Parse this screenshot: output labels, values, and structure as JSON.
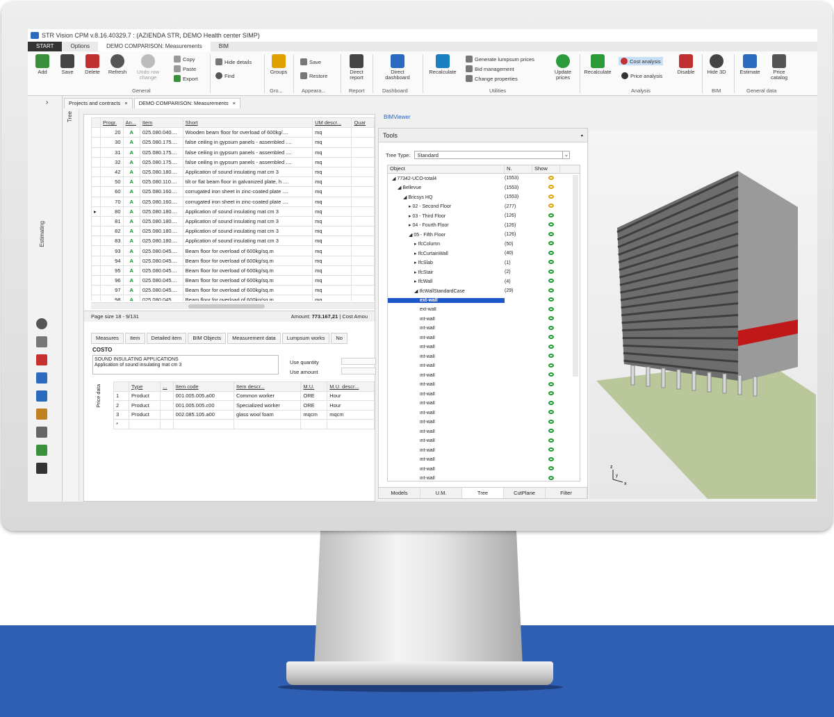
{
  "window": {
    "title": "STR Vision CPM v.8.16.40329.7 : (AZIENDA STR, DEMO Health center SIMP)"
  },
  "menu": [
    "START",
    "Options",
    "DEMO COMPARISON: Measurements",
    "BIM"
  ],
  "ribbon": {
    "add": "Add",
    "save": "Save",
    "delete": "Delete",
    "refresh": "Refresh",
    "undo": "Undo row change",
    "copy": "Copy",
    "paste": "Paste",
    "export": "Export",
    "hide_details": "Hide details",
    "find": "Find",
    "groups": "Groups",
    "save2": "Save",
    "restore": "Restore",
    "direct_report": "Direct report",
    "direct_dashboard": "Direct dashboard",
    "recalculate": "Recalculate",
    "gen_lumpsum": "Generate lumpsum prices",
    "bid_mgmt": "Bid management",
    "change_props": "Change properties",
    "update_prices": "Update prices",
    "recalculate2": "Recalculate",
    "cost_analysis": "Cost analysis",
    "price_analysis": "Price analysis",
    "disable": "Disable",
    "hide3d": "Hide 3D",
    "estimate": "Estimate",
    "price_catalog": "Price catalog",
    "groups_labels": {
      "general": "General",
      "gro": "Gro...",
      "appearance": "Appeara...",
      "report": "Report",
      "dashboard": "Dashboard",
      "utilities": "Utilities",
      "analysis": "Analysis",
      "bim": "BIM",
      "general_data": "General data"
    }
  },
  "doc_tabs": [
    "Projects and contracts",
    "DEMO COMPARISON: Measurements"
  ],
  "left_strip": {
    "label": "Estimating",
    "tree": "Tree"
  },
  "measures": {
    "columns": [
      "Progr.",
      "An...",
      "Item",
      "Short",
      "UM descr...",
      "Quar"
    ],
    "rows": [
      [
        "20",
        "A",
        "025.080.040....",
        "Wooden beam floor for overload of 600kg/....",
        "mq"
      ],
      [
        "30",
        "A",
        "025.080.175....",
        "false ceiling in gypsum panels - assembled ....",
        "mq"
      ],
      [
        "31",
        "A",
        "025.080.175....",
        "false ceiling in gypsum panels - assembled ....",
        "mq"
      ],
      [
        "32",
        "A",
        "025.080.175....",
        "false ceiling in gypsum panels - assembled ....",
        "mq"
      ],
      [
        "42",
        "A",
        "025.080.180....",
        "Application of sound insulating mat cm 3",
        "mq"
      ],
      [
        "50",
        "A",
        "025.080.110....",
        "tilt or flat beam floor in galvanized plate, h ....",
        "mq"
      ],
      [
        "60",
        "A",
        "025.080.160....",
        "corrugated iron sheet in zinc-coated plate ....",
        "mq"
      ],
      [
        "70",
        "A",
        "025.080.160....",
        "corrugated iron sheet in zinc-coated plate ....",
        "mq"
      ],
      [
        "80",
        "A",
        "025.080.180....",
        "Application of sound insulating mat cm 3",
        "mq"
      ],
      [
        "81",
        "A",
        "025.080.180....",
        "Application of sound insulating mat cm 3",
        "mq"
      ],
      [
        "82",
        "A",
        "025.080.180....",
        "Application of sound insulating mat cm 3",
        "mq"
      ],
      [
        "83",
        "A",
        "025.080.180....",
        "Application of sound insulating mat cm 3",
        "mq"
      ],
      [
        "93",
        "A",
        "025.080.045....",
        "Beam floor for overload of 600kg/sq.m",
        "mq"
      ],
      [
        "94",
        "A",
        "025.080.045....",
        "Beam floor for overload of 600kg/sq.m",
        "mq"
      ],
      [
        "95",
        "A",
        "025.080.045....",
        "Beam floor for overload of 600kg/sq.m",
        "mq"
      ],
      [
        "96",
        "A",
        "025.080.045....",
        "Beam floor for overload of 600kg/sq.m",
        "mq"
      ],
      [
        "97",
        "A",
        "025.080.045....",
        "Beam floor for overload of 600kg/sq.m",
        "mq"
      ],
      [
        "98",
        "A",
        "025.080.045....",
        "Beam floor for overload of 600kg/sq.m",
        "mq"
      ]
    ],
    "page_size": "Page size 18 - 9/131",
    "amount_label": "Amount:",
    "amount_value": "773.167,21",
    "cost_label": "| Cost Amou"
  },
  "sub_tabs": [
    "Measures",
    "Item",
    "Detailed item",
    "BIM Objects",
    "Measurement data",
    "Lumpsum works",
    "No"
  ],
  "costo": {
    "label": "COSTO",
    "line1": "SOUND INSULATING APPLICATIONS",
    "line2": "Application of sound insulating mat cm 3",
    "use_quantity": "Use quantity",
    "use_amount": "Use amount"
  },
  "price_data": {
    "label": "Price data",
    "columns": [
      "Type",
      "...",
      "Item code",
      "Item descr...",
      "M.U.",
      "M.U. descr..."
    ],
    "rows": [
      [
        "1",
        "Product",
        "001.005.005.a00",
        "Common worker",
        "ORE",
        "Hour"
      ],
      [
        "2",
        "Product",
        "001.005.005.c00",
        "Specialized worker",
        "ORE",
        "Hour"
      ],
      [
        "3",
        "Product",
        "002.085.105.a00",
        "glass wool foam",
        "mqcm",
        "mqcm"
      ]
    ]
  },
  "bim": {
    "viewer_title": "BIMViewer",
    "tools_title": "Tools",
    "tree_type_label": "Tree Type:",
    "tree_type_value": "Standard",
    "columns": [
      "Object",
      "N.",
      "Show"
    ],
    "tree": [
      {
        "indent": 0,
        "label": "77342-UCO-total4",
        "n": "(1553)",
        "show": "half"
      },
      {
        "indent": 1,
        "label": "Bellevue",
        "n": "(1553)",
        "show": "half"
      },
      {
        "indent": 2,
        "label": "Bricsys HQ",
        "n": "(1553)",
        "show": "half"
      },
      {
        "indent": 3,
        "label": "02 - Second Floor",
        "n": "(277)",
        "show": "half"
      },
      {
        "indent": 3,
        "label": "03 - Third Floor",
        "n": "(126)",
        "show": "on"
      },
      {
        "indent": 3,
        "label": "04 - Fourth Floor",
        "n": "(126)",
        "show": "on"
      },
      {
        "indent": 3,
        "label": "05 - Fifth Floor",
        "n": "(126)",
        "show": "on"
      },
      {
        "indent": 4,
        "label": "IfcColumn",
        "n": "(50)",
        "show": "on"
      },
      {
        "indent": 4,
        "label": "IfcCurtainWall",
        "n": "(40)",
        "show": "on"
      },
      {
        "indent": 4,
        "label": "IfcSlab",
        "n": "(1)",
        "show": "on"
      },
      {
        "indent": 4,
        "label": "IfcStair",
        "n": "(2)",
        "show": "on"
      },
      {
        "indent": 4,
        "label": "IfcWall",
        "n": "(4)",
        "show": "on"
      },
      {
        "indent": 4,
        "label": "IfcWallStandardCase",
        "n": "(29)",
        "show": "on"
      },
      {
        "indent": 5,
        "label": "ext-wall",
        "n": "",
        "show": "on",
        "selected": true
      },
      {
        "indent": 5,
        "label": "ext-wall",
        "n": "",
        "show": "on"
      },
      {
        "indent": 5,
        "label": "int-wall",
        "n": "",
        "show": "on"
      },
      {
        "indent": 5,
        "label": "int-wall",
        "n": "",
        "show": "on"
      },
      {
        "indent": 5,
        "label": "int-wall",
        "n": "",
        "show": "on"
      },
      {
        "indent": 5,
        "label": "int-wall",
        "n": "",
        "show": "on"
      },
      {
        "indent": 5,
        "label": "int-wall",
        "n": "",
        "show": "on"
      },
      {
        "indent": 5,
        "label": "int-wall",
        "n": "",
        "show": "on"
      },
      {
        "indent": 5,
        "label": "int-wall",
        "n": "",
        "show": "on"
      },
      {
        "indent": 5,
        "label": "int-wall",
        "n": "",
        "show": "on"
      },
      {
        "indent": 5,
        "label": "int-wall",
        "n": "",
        "show": "on"
      },
      {
        "indent": 5,
        "label": "int-wall",
        "n": "",
        "show": "on"
      },
      {
        "indent": 5,
        "label": "int-wall",
        "n": "",
        "show": "on"
      },
      {
        "indent": 5,
        "label": "int-wall",
        "n": "",
        "show": "on"
      },
      {
        "indent": 5,
        "label": "int-wall",
        "n": "",
        "show": "on"
      },
      {
        "indent": 5,
        "label": "int-wall",
        "n": "",
        "show": "on"
      },
      {
        "indent": 5,
        "label": "int-wall",
        "n": "",
        "show": "on"
      },
      {
        "indent": 5,
        "label": "int-wall",
        "n": "",
        "show": "on"
      },
      {
        "indent": 5,
        "label": "int-wall",
        "n": "",
        "show": "on"
      },
      {
        "indent": 5,
        "label": "int-wall",
        "n": "",
        "show": "on"
      },
      {
        "indent": 5,
        "label": "int-wall",
        "n": "",
        "show": "on"
      }
    ],
    "tabs": [
      "Models",
      "U.M.",
      "Tree",
      "CutPlane",
      "Filter"
    ],
    "axis": {
      "z": "z",
      "y": "y",
      "x": "x"
    }
  },
  "colors": {
    "accent": "#2a6bbf",
    "band": "#2f5fb3",
    "selection": "#1c56c8",
    "highlight": "#c01818"
  }
}
